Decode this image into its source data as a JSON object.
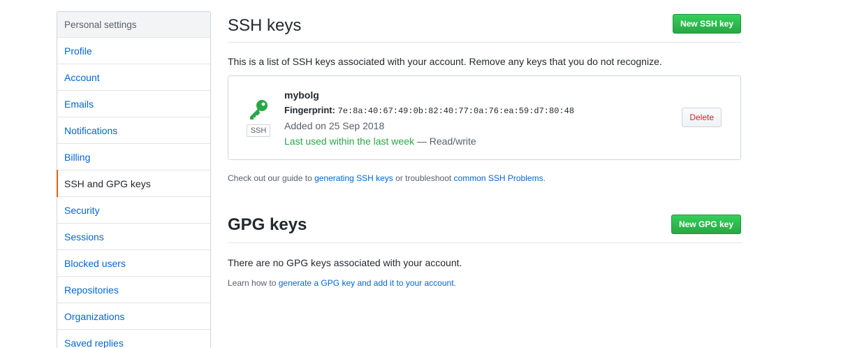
{
  "sidebar": {
    "header": "Personal settings",
    "items": [
      {
        "label": "Profile"
      },
      {
        "label": "Account"
      },
      {
        "label": "Emails"
      },
      {
        "label": "Notifications"
      },
      {
        "label": "Billing"
      },
      {
        "label": "SSH and GPG keys",
        "selected": true
      },
      {
        "label": "Security"
      },
      {
        "label": "Sessions"
      },
      {
        "label": "Blocked users"
      },
      {
        "label": "Repositories"
      },
      {
        "label": "Organizations"
      },
      {
        "label": "Saved replies"
      }
    ]
  },
  "ssh": {
    "title": "SSH keys",
    "new_button": "New SSH key",
    "description": "This is a list of SSH keys associated with your account. Remove any keys that you do not recognize.",
    "key": {
      "icon": "key-icon",
      "badge": "SSH",
      "name": "mybolg",
      "fingerprint_label": "Fingerprint:",
      "fingerprint": "7e:8a:40:67:49:0b:82:40:77:0a:76:ea:59:d7:80:48",
      "added": "Added on 25 Sep 2018",
      "last_used": "Last used within the last week",
      "access": "— Read/write",
      "delete_button": "Delete"
    },
    "guide": {
      "prefix": "Check out our guide to ",
      "link1": "generating SSH keys",
      "middle": " or troubleshoot ",
      "link2": "common SSH Problems",
      "suffix": "."
    }
  },
  "gpg": {
    "title": "GPG keys",
    "new_button": "New GPG key",
    "empty_text": "There are no GPG keys associated with your account.",
    "learn": {
      "prefix": "Learn how to ",
      "link": "generate a GPG key and add it to your account",
      "suffix": "."
    }
  },
  "colors": {
    "accent": "#0366d6",
    "primary_button": "#28a745",
    "selected_marker": "#e36209",
    "danger": "#cb2431"
  }
}
